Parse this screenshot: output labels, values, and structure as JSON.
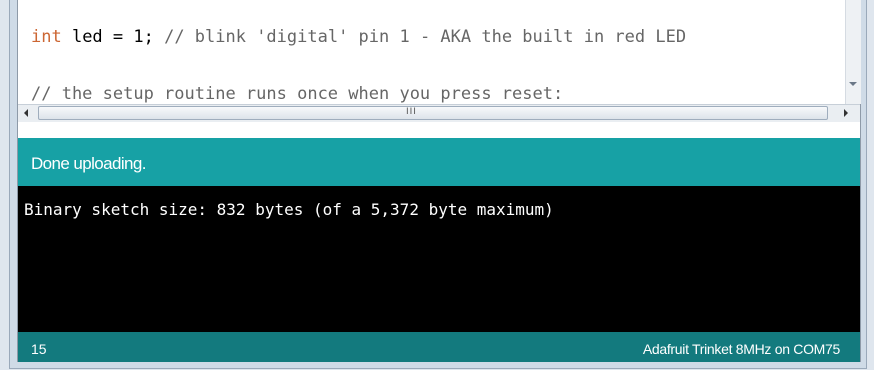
{
  "editor": {
    "line1": {
      "keyword": "int",
      "code": " led = 1;",
      "comment": " // blink 'digital' pin 1 - AKA the built in red LED"
    },
    "line2": {
      "comment": "// the setup routine runs once when you press reset:"
    }
  },
  "scrollbar": {
    "grip": "III"
  },
  "status": {
    "message": "Done uploading."
  },
  "console": {
    "output": "Binary sketch size: 832 bytes (of a 5,372 byte maximum)"
  },
  "footer": {
    "line_number": "15",
    "board_port": "Adafruit Trinket 8MHz on COM75"
  },
  "colors": {
    "status_bg": "#17a1a5",
    "footer_bg": "#137a7e",
    "console_bg": "#000000",
    "keyword": "#cc6633"
  }
}
